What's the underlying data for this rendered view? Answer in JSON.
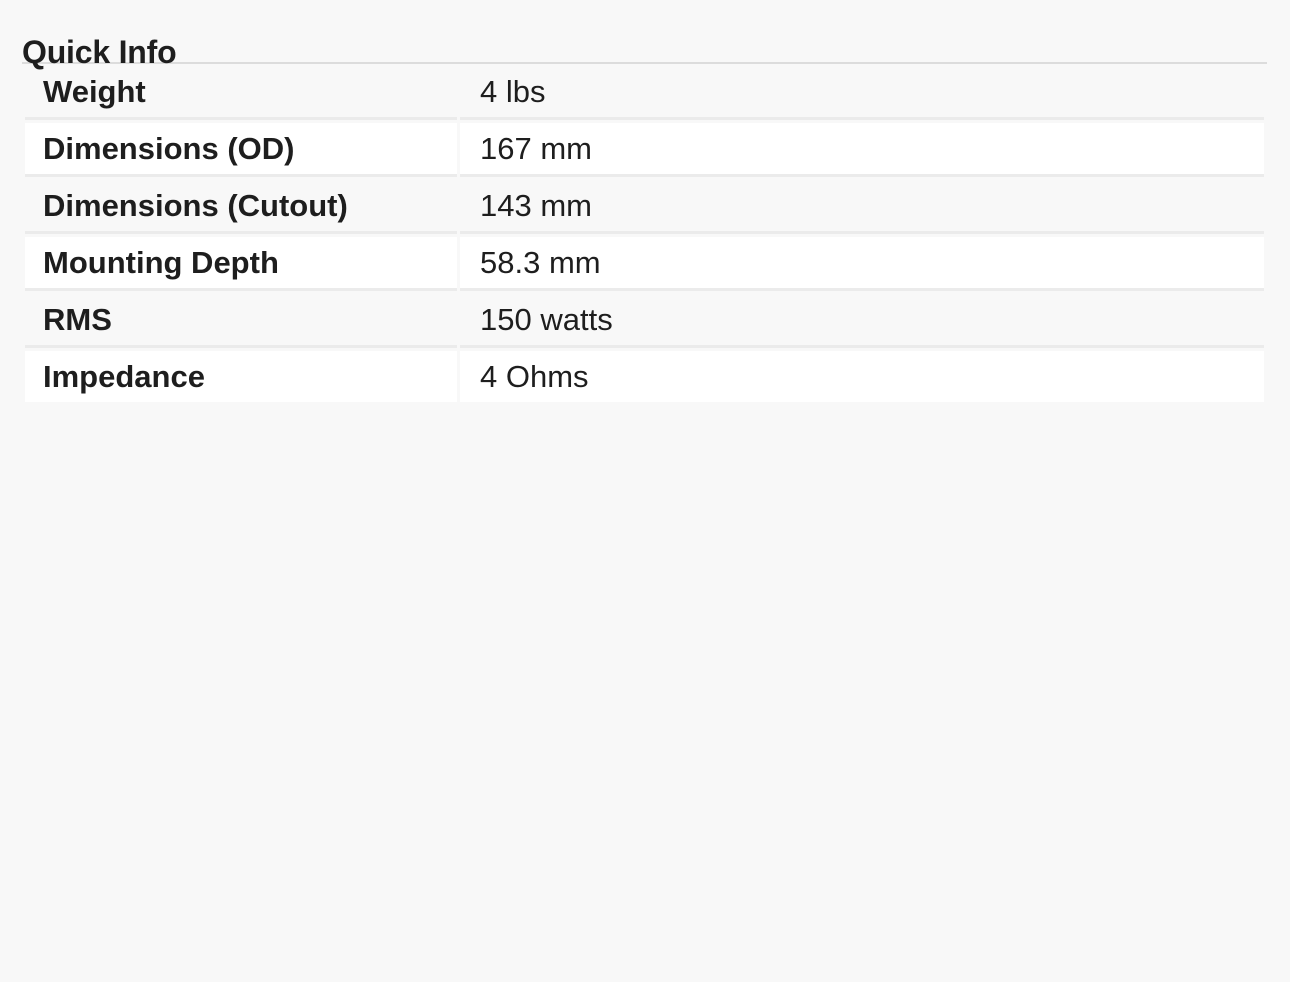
{
  "section": {
    "title": "Quick Info"
  },
  "specs": [
    {
      "label": "Weight",
      "value": "4 lbs"
    },
    {
      "label": "Dimensions (OD)",
      "value": "167 mm"
    },
    {
      "label": "Dimensions (Cutout)",
      "value": "143 mm"
    },
    {
      "label": "Mounting Depth",
      "value": "58.3 mm"
    },
    {
      "label": "RMS",
      "value": "150 watts"
    },
    {
      "label": "Impedance",
      "value": "4 Ohms"
    }
  ],
  "colors": {
    "background": "#f8f8f8",
    "row_alt": "#ffffff",
    "divider": "#dcdcdc",
    "text": "#1e1e1e"
  }
}
